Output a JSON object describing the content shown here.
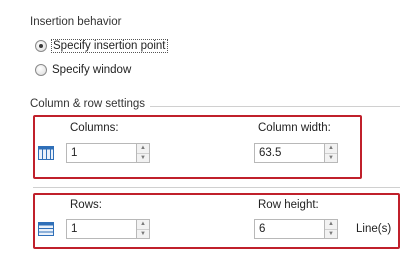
{
  "insertion_behavior": {
    "title": "Insertion behavior",
    "options": [
      {
        "label": "Specify insertion point",
        "selected": true
      },
      {
        "label": "Specify window",
        "selected": false
      }
    ]
  },
  "column_row": {
    "title": "Column & row settings",
    "columns_label": "Columns:",
    "columns_value": "1",
    "column_width_label": "Column width:",
    "column_width_value": "63.5",
    "rows_label": "Rows:",
    "rows_value": "1",
    "row_height_label": "Row height:",
    "row_height_value": "6",
    "row_height_unit": "Line(s)"
  },
  "colors": {
    "highlight": "#c0202b",
    "icon_blue": "#2f6fb8"
  },
  "icons": {
    "columns": "table-columns-icon",
    "rows": "table-rows-icon"
  }
}
